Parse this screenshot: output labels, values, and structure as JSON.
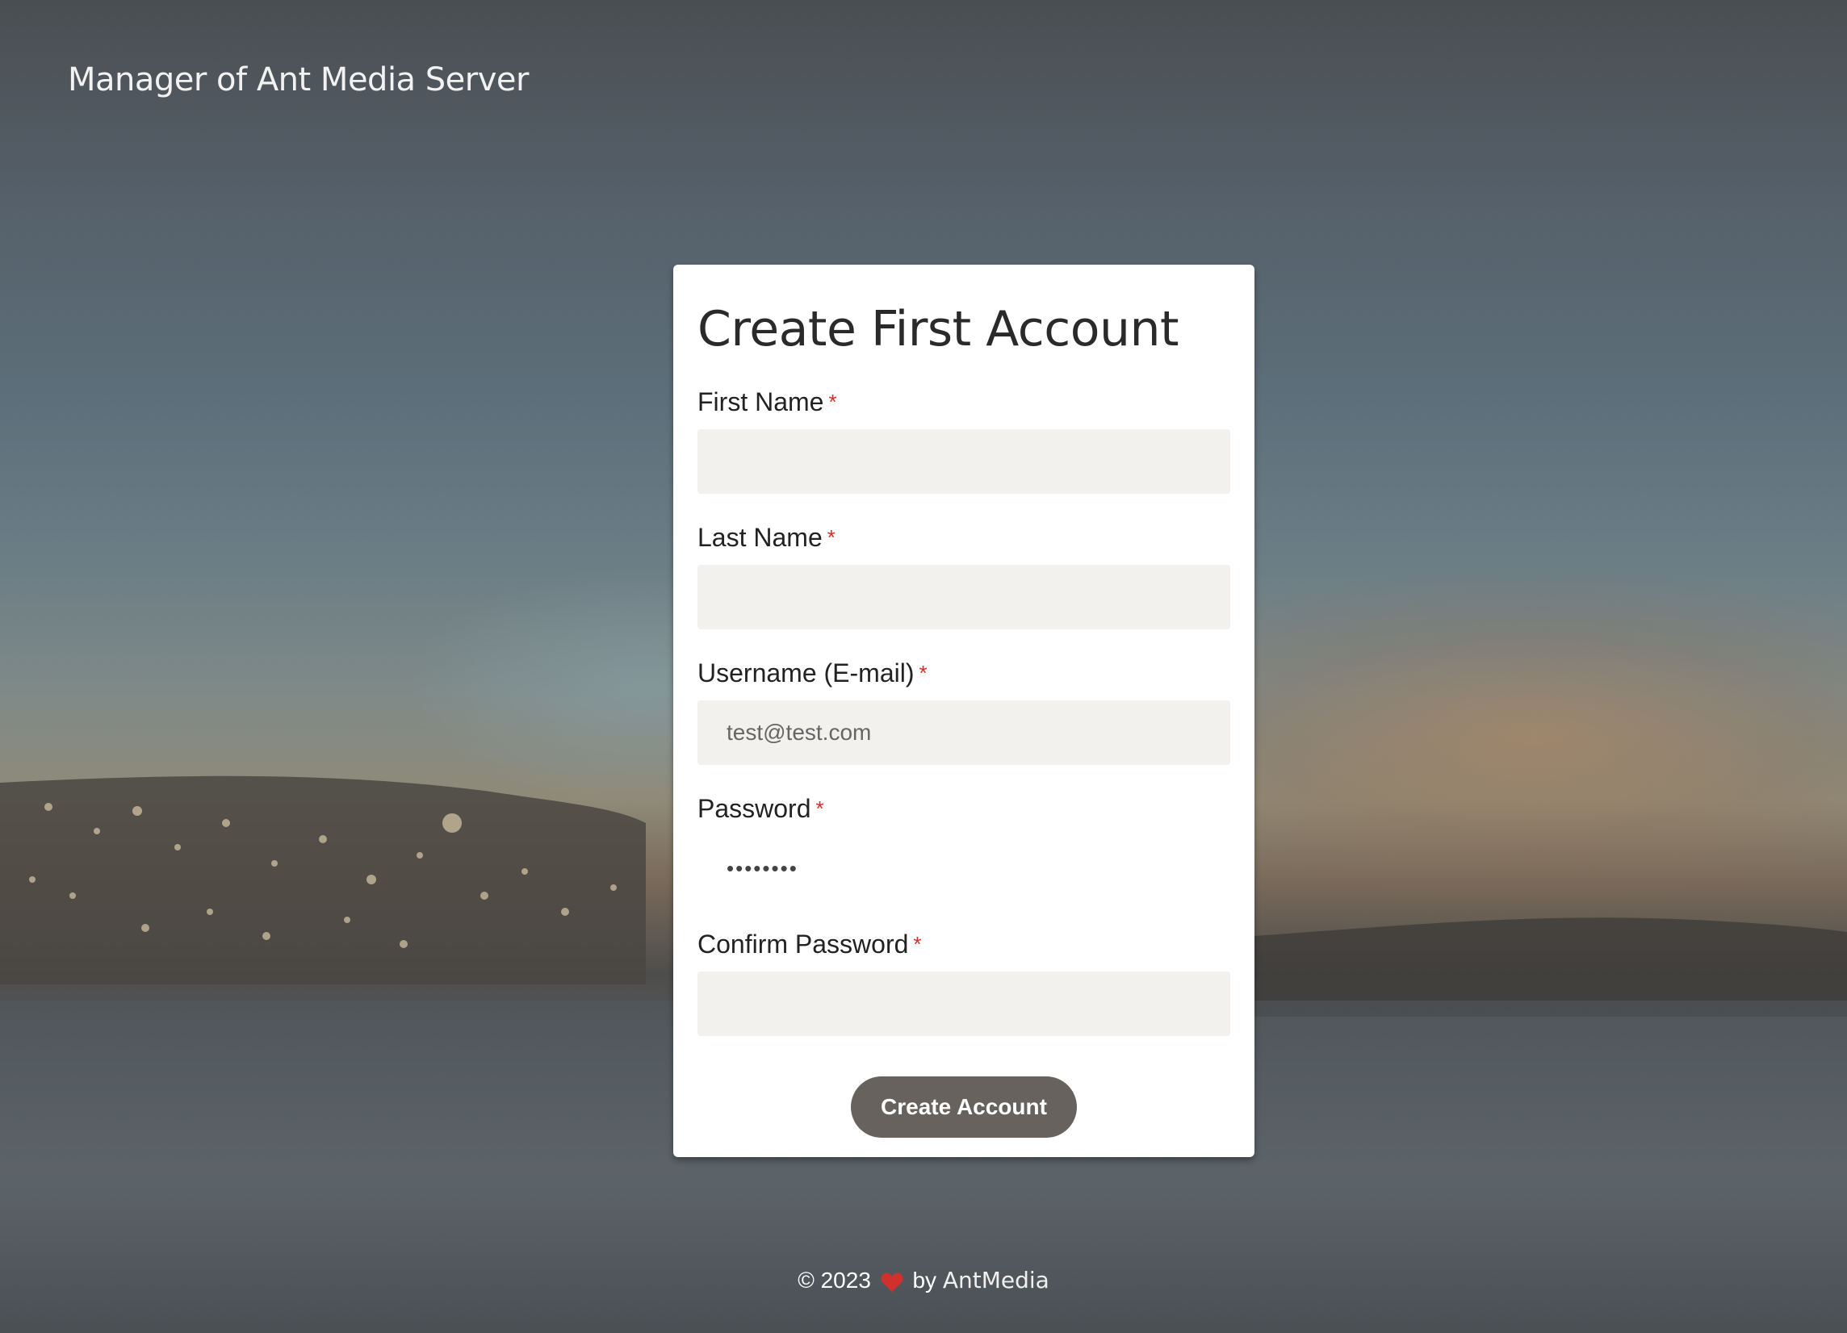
{
  "header": {
    "app_title": "Manager of Ant Media Server"
  },
  "form": {
    "title": "Create First Account",
    "required_mark": "*",
    "fields": {
      "first_name": {
        "label": "First Name",
        "value": "",
        "placeholder": ""
      },
      "last_name": {
        "label": "Last Name",
        "value": "",
        "placeholder": ""
      },
      "username": {
        "label": "Username (E-mail)",
        "value": "",
        "placeholder": "test@test.com"
      },
      "password": {
        "label": "Password",
        "value": "••••••••",
        "placeholder": ""
      },
      "confirm_password": {
        "label": "Confirm Password",
        "value": "",
        "placeholder": ""
      }
    },
    "submit_label": "Create Account"
  },
  "footer": {
    "copyright": "© 2023",
    "by": "by",
    "brand": "AntMedia",
    "heart_icon": "heart-icon"
  },
  "colors": {
    "required": "#d0312d",
    "button_bg": "#67625d",
    "input_bg": "#f2f1ee",
    "heart": "#d0312d"
  }
}
